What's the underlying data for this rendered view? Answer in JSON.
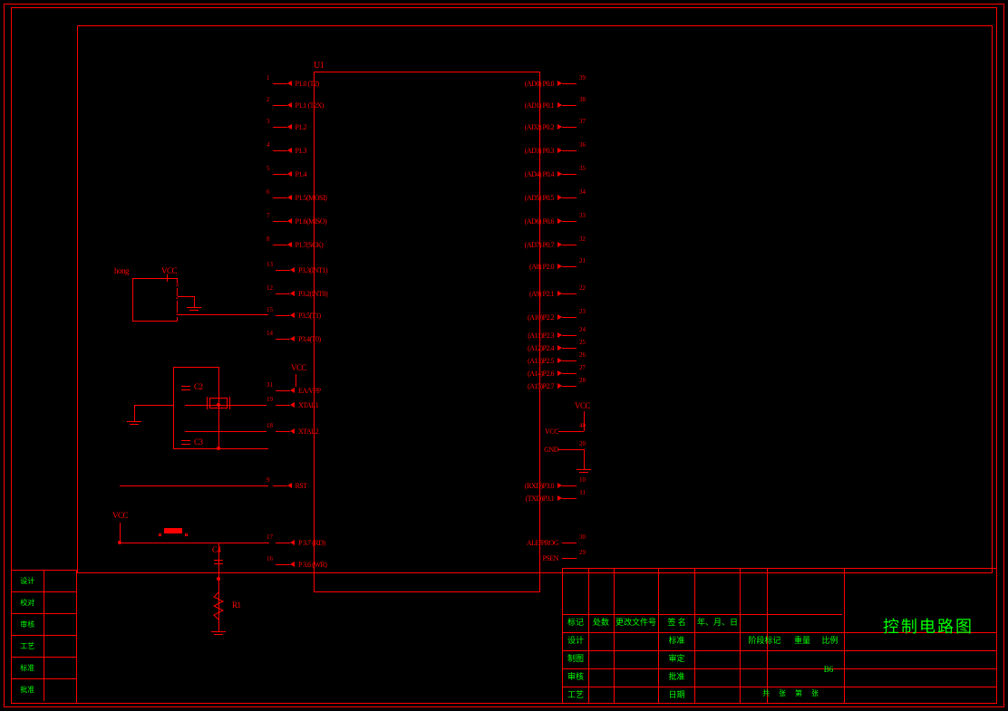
{
  "chip": {
    "ref": "U1",
    "left_pins": [
      {
        "num": "1",
        "label": "P1.0 (T2)"
      },
      {
        "num": "2",
        "label": "P1.1 (T2X)"
      },
      {
        "num": "3",
        "label": "P1.2"
      },
      {
        "num": "4",
        "label": "P1.3"
      },
      {
        "num": "5",
        "label": "P1.4"
      },
      {
        "num": "6",
        "label": "P1.5(MOSI)"
      },
      {
        "num": "7",
        "label": "P1.6(MISO)"
      },
      {
        "num": "8",
        "label": "P1.7(SCK)"
      },
      {
        "num": "13",
        "label": "P3.3(INT1)"
      },
      {
        "num": "12",
        "label": "P3.2(INT0)"
      },
      {
        "num": "15",
        "label": "P3.5(T1)"
      },
      {
        "num": "14",
        "label": "P3.4(T0)"
      },
      {
        "num": "",
        "label": ""
      },
      {
        "num": "31",
        "label": "EA/VPP"
      },
      {
        "num": "19",
        "label": "XTAL1"
      },
      {
        "num": "",
        "label": ""
      },
      {
        "num": "18",
        "label": "XTAL2"
      },
      {
        "num": "",
        "label": ""
      },
      {
        "num": "9",
        "label": "RST"
      },
      {
        "num": "",
        "label": ""
      },
      {
        "num": "",
        "label": ""
      },
      {
        "num": "17",
        "label": "P 3.7 (RD)"
      },
      {
        "num": "16",
        "label": "P 3.6 (WR)"
      }
    ],
    "right_pins": [
      {
        "num": "39",
        "label": "(AD0) P0.0"
      },
      {
        "num": "38",
        "label": "(AD1) P0.1"
      },
      {
        "num": "37",
        "label": "(AD2) P0.2"
      },
      {
        "num": "36",
        "label": "(AD3) P0.3"
      },
      {
        "num": "35",
        "label": "(AD4) P0.4"
      },
      {
        "num": "34",
        "label": "(AD5) P0.5"
      },
      {
        "num": "33",
        "label": "(AD6) P0.6"
      },
      {
        "num": "32",
        "label": "(AD7) P0.7"
      },
      {
        "num": "21",
        "label": "(A8) P2.0"
      },
      {
        "num": "22",
        "label": "(A9) P2.1"
      },
      {
        "num": "23",
        "label": "(A10)P2.2"
      },
      {
        "num": "24",
        "label": "(A11)P2.3"
      },
      {
        "num": "25",
        "label": "(A12)P2.4"
      },
      {
        "num": "26",
        "label": "(A13)P2.5"
      },
      {
        "num": "27",
        "label": "(A14)P2.6"
      },
      {
        "num": "28",
        "label": "(A15)P2.7"
      },
      {
        "num": "",
        "label": ""
      },
      {
        "num": "40",
        "label": "VCC"
      },
      {
        "num": "20",
        "label": "GND"
      },
      {
        "num": "",
        "label": ""
      },
      {
        "num": "10",
        "label": "(RXD)P3.0"
      },
      {
        "num": "11",
        "label": "(TXD)P3.1"
      },
      {
        "num": "",
        "label": ""
      },
      {
        "num": "30",
        "label": "ALE/PROG"
      },
      {
        "num": "29",
        "label": "PSEN"
      }
    ]
  },
  "external": {
    "hong": "hong",
    "vcc": "VCC",
    "c2": "C2",
    "c3": "C3",
    "c4": "C4",
    "r1": "R1"
  },
  "side_table": [
    "设计",
    "校对",
    "审核",
    "工艺",
    "标准",
    "批准"
  ],
  "titleblock": {
    "title": "控制电路图",
    "row1": [
      "标记",
      "处数",
      "更改文件号",
      "签 名",
      "年、月、日"
    ],
    "col1": [
      "设计",
      "制图",
      "审核",
      "工艺"
    ],
    "col2": [
      "标准",
      "审定",
      "批准",
      "日期"
    ],
    "upper": [
      "阶段标记",
      "重量",
      "比例"
    ],
    "sheet": "共    张    第    张",
    "b6": "B6"
  }
}
